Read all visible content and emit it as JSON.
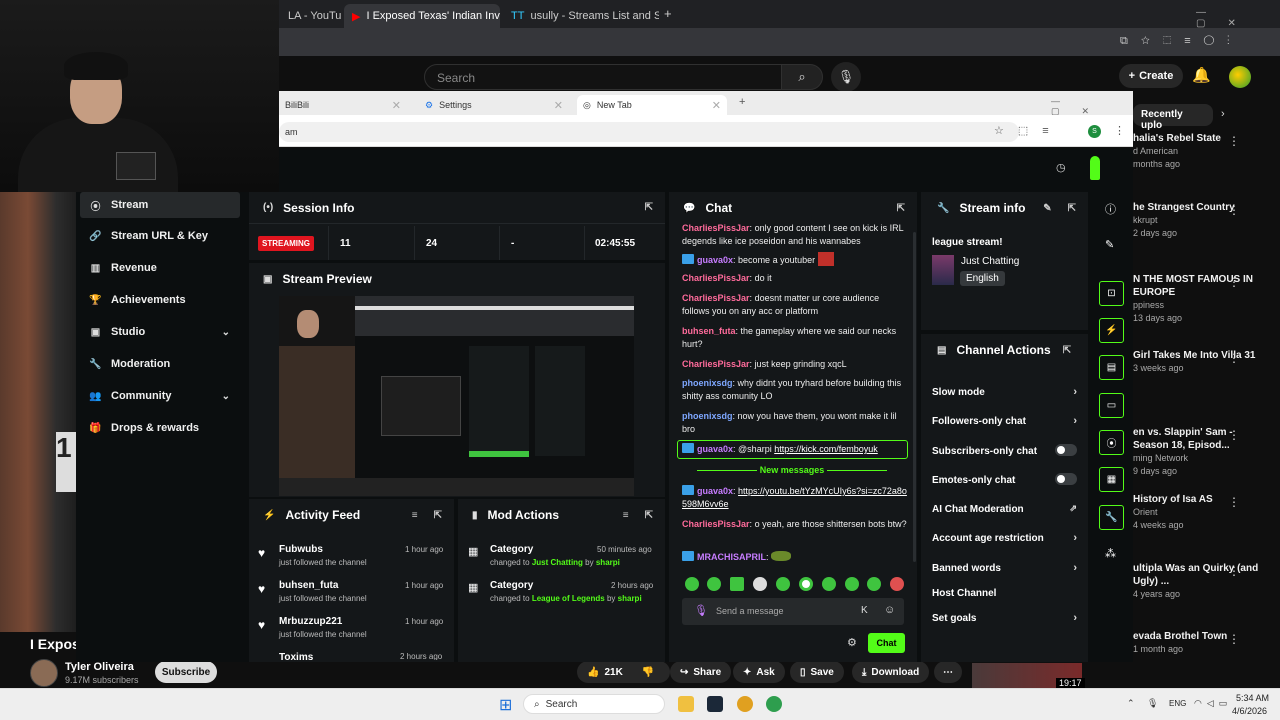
{
  "back_browser": {
    "tabs": [
      {
        "label": "LA - YouTu"
      },
      {
        "label": "I Exposed Texas' Indian Invasio"
      },
      {
        "label": "usully - Streams List and Statist"
      }
    ]
  },
  "youtube": {
    "search_placeholder": "Search",
    "create_label": "Create",
    "recently_label": "Recently uplo",
    "video_title": "I Expos",
    "channel_name": "Tyler Oliveira",
    "channel_subs": "9.17M subscribers",
    "subscribe_label": "Subscribe",
    "actions": {
      "likes": "21K",
      "share": "Share",
      "ask": "Ask",
      "save": "Save",
      "download": "Download"
    },
    "thumb_time": "19:17",
    "sidebar_videos": [
      {
        "title": "halia's Rebel State",
        "sub1": "d American",
        "sub2": "months ago"
      },
      {
        "title": "he Strangest Country",
        "sub1": "kkrupt",
        "sub2": "2 days ago"
      },
      {
        "title": "N THE MOST FAMOUS IN EUROPE",
        "sub1": "ppiness",
        "sub2": "13 days ago"
      },
      {
        "title": "Girl Takes Me Into Villa 31",
        "sub1": "",
        "sub2": "3 weeks ago"
      },
      {
        "title": "en vs. Slappin' Sam - Season 18, Episod...",
        "sub1": "ming Network",
        "sub2": "9 days ago"
      },
      {
        "title": "History of Isa AS",
        "sub1": "Orient",
        "sub2": "4 weeks ago"
      },
      {
        "title": "ultipla Was an Quirky (and Ugly) ...",
        "sub1": "",
        "sub2": "4 years ago"
      },
      {
        "title": "evada Brothel Town",
        "sub1": "",
        "sub2": "1 month ago"
      }
    ]
  },
  "front_browser": {
    "tabs": [
      {
        "label": "BiliBili"
      },
      {
        "label": "Settings"
      },
      {
        "label": "New Tab"
      }
    ],
    "url": "am"
  },
  "nav": {
    "items": [
      {
        "label": "Stream"
      },
      {
        "label": "Stream URL & Key"
      },
      {
        "label": "Revenue"
      },
      {
        "label": "Achievements"
      },
      {
        "label": "Studio"
      },
      {
        "label": "Moderation"
      },
      {
        "label": "Community"
      },
      {
        "label": "Drops & rewards"
      }
    ]
  },
  "session": {
    "title": "Session Info",
    "status": "STREAMING",
    "viewers": "11",
    "followers": "24",
    "subs": "-",
    "uptime": "02:45:55"
  },
  "preview": {
    "title": "Stream Preview"
  },
  "activity": {
    "title": "Activity Feed",
    "items": [
      {
        "name": "Fubwubs",
        "action": "just followed the channel",
        "time": "1 hour ago"
      },
      {
        "name": "buhsen_futa",
        "action": "just followed the channel",
        "time": "1 hour ago"
      },
      {
        "name": "Mrbuzzup221",
        "action": "just followed the channel",
        "time": "1 hour ago"
      },
      {
        "name": "Toxims",
        "action": "",
        "time": "2 hours ago"
      }
    ]
  },
  "mod_actions": {
    "title": "Mod Actions",
    "items": [
      {
        "type": "Category",
        "prefix": "changed to",
        "value": "Just Chatting",
        "by": "by",
        "mod": "sharpi",
        "time": "50 minutes ago"
      },
      {
        "type": "Category",
        "prefix": "changed to",
        "value": "League of Legends",
        "by": "by",
        "mod": "sharpi",
        "time": "2 hours ago"
      }
    ]
  },
  "chat": {
    "title": "Chat",
    "messages": [
      {
        "user": "CharliesPissJar",
        "text": "only good content I see on kick is IRL degends like ice poseidon and his wannabes",
        "color": "#ff6b9b"
      },
      {
        "user": "guava0x",
        "text": "become a youtuber",
        "color": "#53fc18"
      },
      {
        "user": "CharliesPissJar",
        "text": "do it",
        "color": "#ff6b9b"
      },
      {
        "user": "CharliesPissJar",
        "text": "doesnt matter ur core audience follows you on any acc or platform",
        "color": "#ff6b9b"
      },
      {
        "user": "buhsen_futa",
        "text": "the gameplay where we said our necks hurt?",
        "color": "#ff6b9b"
      },
      {
        "user": "CharliesPissJar",
        "text": "just keep grinding xqcL",
        "color": "#ff6b9b"
      },
      {
        "user": "phoenixsdg",
        "text": "why didnt you tryhard before building this shitty ass comunity LO",
        "color": "#7ea7ff"
      },
      {
        "user": "phoenixsdg",
        "text": "now you have them, you wont make it lil bro",
        "color": "#7ea7ff"
      },
      {
        "user": "guava0x",
        "text": "@sharpi",
        "link": "https://kick.com/femboyuk",
        "color": "#53fc18"
      },
      {
        "user": "guava0x",
        "link": "https://youtu.be/tYzMYcUIy6s?si=zc72a8o598M6vv6e",
        "color": "#53fc18"
      },
      {
        "user": "CharliesPissJar",
        "text": "o yeah, are those shittersen bots btw?",
        "color": "#ff6b9b"
      },
      {
        "user": "MRACHISAPRIL",
        "text": "",
        "color": "#c77dff"
      }
    ],
    "new_messages": "New messages",
    "input_placeholder": "Send a message",
    "send_label": "Chat"
  },
  "stream_info": {
    "title": "Stream info",
    "stream_title": "league stream!",
    "category": "Just Chatting",
    "language": "English"
  },
  "channel_actions": {
    "title": "Channel Actions",
    "items": [
      {
        "label": "Slow mode",
        "control": "chevron"
      },
      {
        "label": "Followers-only chat",
        "control": "chevron"
      },
      {
        "label": "Subscribers-only chat",
        "control": "toggle"
      },
      {
        "label": "Emotes-only chat",
        "control": "toggle"
      },
      {
        "label": "AI Chat Moderation",
        "control": "external"
      },
      {
        "label": "Account age restriction",
        "control": "chevron"
      },
      {
        "label": "Banned words",
        "control": "chevron"
      },
      {
        "label": "Host Channel",
        "control": "none"
      },
      {
        "label": "Set goals",
        "control": "chevron"
      }
    ]
  },
  "taskbar": {
    "search": "Search",
    "lang": "ENG",
    "time": "5:34 AM",
    "date": "4/6/2026"
  },
  "colors": {
    "kick_green": "#53fc18",
    "streaming_red": "#e0151f"
  }
}
